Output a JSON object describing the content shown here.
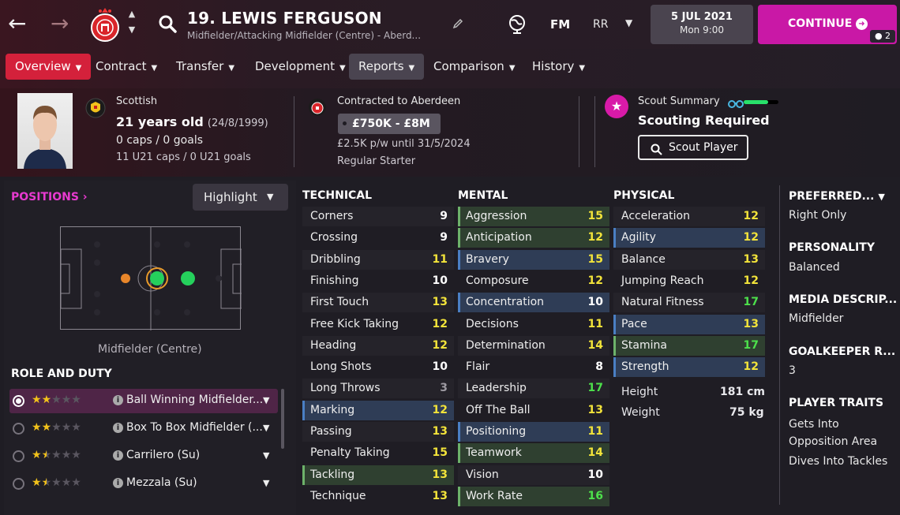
{
  "topbar": {
    "player_title": "19. LEWIS FERGUSON",
    "player_subtitle": "Midfielder/Attacking Midfielder (Centre) - Aberd...",
    "fm_label": "FM",
    "rr_label": "RR",
    "date": "5 JUL 2021",
    "day_time": "Mon 9:00",
    "continue_label": "CONTINUE",
    "continue_count": "2"
  },
  "tabs": [
    {
      "label": "Overview"
    },
    {
      "label": "Contract"
    },
    {
      "label": "Transfer"
    },
    {
      "label": "Development"
    },
    {
      "label": "Reports"
    },
    {
      "label": "Comparison"
    },
    {
      "label": "History"
    }
  ],
  "bio": {
    "nationality": "Scottish",
    "age": "21 years old",
    "dob": "(24/8/1999)",
    "caps": "0 caps / 0 goals",
    "u21_caps": "11 U21 caps / 0 U21 goals"
  },
  "contract": {
    "club": "Contracted to Aberdeen",
    "value": "£750K - £8M",
    "wage": "£2.5K p/w until 31/5/2024",
    "status": "Regular Starter"
  },
  "scout": {
    "label": "Scout Summary",
    "status": "Scouting Required",
    "button": "Scout Player",
    "knowledge_fraction": 0.7
  },
  "positions": {
    "title": "POSITIONS",
    "highlight": "Highlight",
    "position_label": "Midfielder (Centre)",
    "role_title": "ROLE AND DUTY",
    "roles": [
      {
        "label": "Ball Winning Midfielder...",
        "stars": 2
      },
      {
        "label": "Box To Box Midfielder (...",
        "stars": 2
      },
      {
        "label": "Carrilero (Su)",
        "stars": 1.5
      },
      {
        "label": "Mezzala (Su)",
        "stars": 1.5
      }
    ]
  },
  "technical": {
    "title": "TECHNICAL",
    "rows": [
      {
        "label": "Corners",
        "value": "9"
      },
      {
        "label": "Crossing",
        "value": "9"
      },
      {
        "label": "Dribbling",
        "value": "11"
      },
      {
        "label": "Finishing",
        "value": "10"
      },
      {
        "label": "First Touch",
        "value": "13"
      },
      {
        "label": "Free Kick Taking",
        "value": "12"
      },
      {
        "label": "Heading",
        "value": "12"
      },
      {
        "label": "Long Shots",
        "value": "10"
      },
      {
        "label": "Long Throws",
        "value": "3"
      },
      {
        "label": "Marking",
        "value": "12"
      },
      {
        "label": "Passing",
        "value": "13"
      },
      {
        "label": "Penalty Taking",
        "value": "15"
      },
      {
        "label": "Tackling",
        "value": "13"
      },
      {
        "label": "Technique",
        "value": "13"
      }
    ]
  },
  "mental": {
    "title": "MENTAL",
    "rows": [
      {
        "label": "Aggression",
        "value": "15"
      },
      {
        "label": "Anticipation",
        "value": "12"
      },
      {
        "label": "Bravery",
        "value": "15"
      },
      {
        "label": "Composure",
        "value": "12"
      },
      {
        "label": "Concentration",
        "value": "10"
      },
      {
        "label": "Decisions",
        "value": "11"
      },
      {
        "label": "Determination",
        "value": "14"
      },
      {
        "label": "Flair",
        "value": "8"
      },
      {
        "label": "Leadership",
        "value": "17"
      },
      {
        "label": "Off The Ball",
        "value": "13"
      },
      {
        "label": "Positioning",
        "value": "11"
      },
      {
        "label": "Teamwork",
        "value": "14"
      },
      {
        "label": "Vision",
        "value": "10"
      },
      {
        "label": "Work Rate",
        "value": "16"
      }
    ]
  },
  "physical": {
    "title": "PHYSICAL",
    "rows": [
      {
        "label": "Acceleration",
        "value": "12"
      },
      {
        "label": "Agility",
        "value": "12"
      },
      {
        "label": "Balance",
        "value": "13"
      },
      {
        "label": "Jumping Reach",
        "value": "12"
      },
      {
        "label": "Natural Fitness",
        "value": "17"
      },
      {
        "label": "Pace",
        "value": "13"
      },
      {
        "label": "Stamina",
        "value": "17"
      },
      {
        "label": "Strength",
        "value": "12"
      }
    ],
    "height_label": "Height",
    "height": "181 cm",
    "weight_label": "Weight",
    "weight": "75 kg"
  },
  "side": {
    "preferred_title": "PREFERRED...",
    "preferred_value": "Right Only",
    "personality_title": "PERSONALITY",
    "personality_value": "Balanced",
    "media_title": "MEDIA DESCRIP...",
    "media_value": "Midfielder",
    "gk_title": "GOALKEEPER R...",
    "gk_value": "3",
    "traits_title": "PLAYER TRAITS",
    "traits": [
      "Gets Into",
      "Opposition Area",
      "Dives Into Tackles"
    ]
  },
  "colors": {
    "accent": "#c918a6",
    "tab_active": "#d4213b",
    "highlight_blue": "#2f3d56",
    "highlight_green": "#2f4030"
  }
}
